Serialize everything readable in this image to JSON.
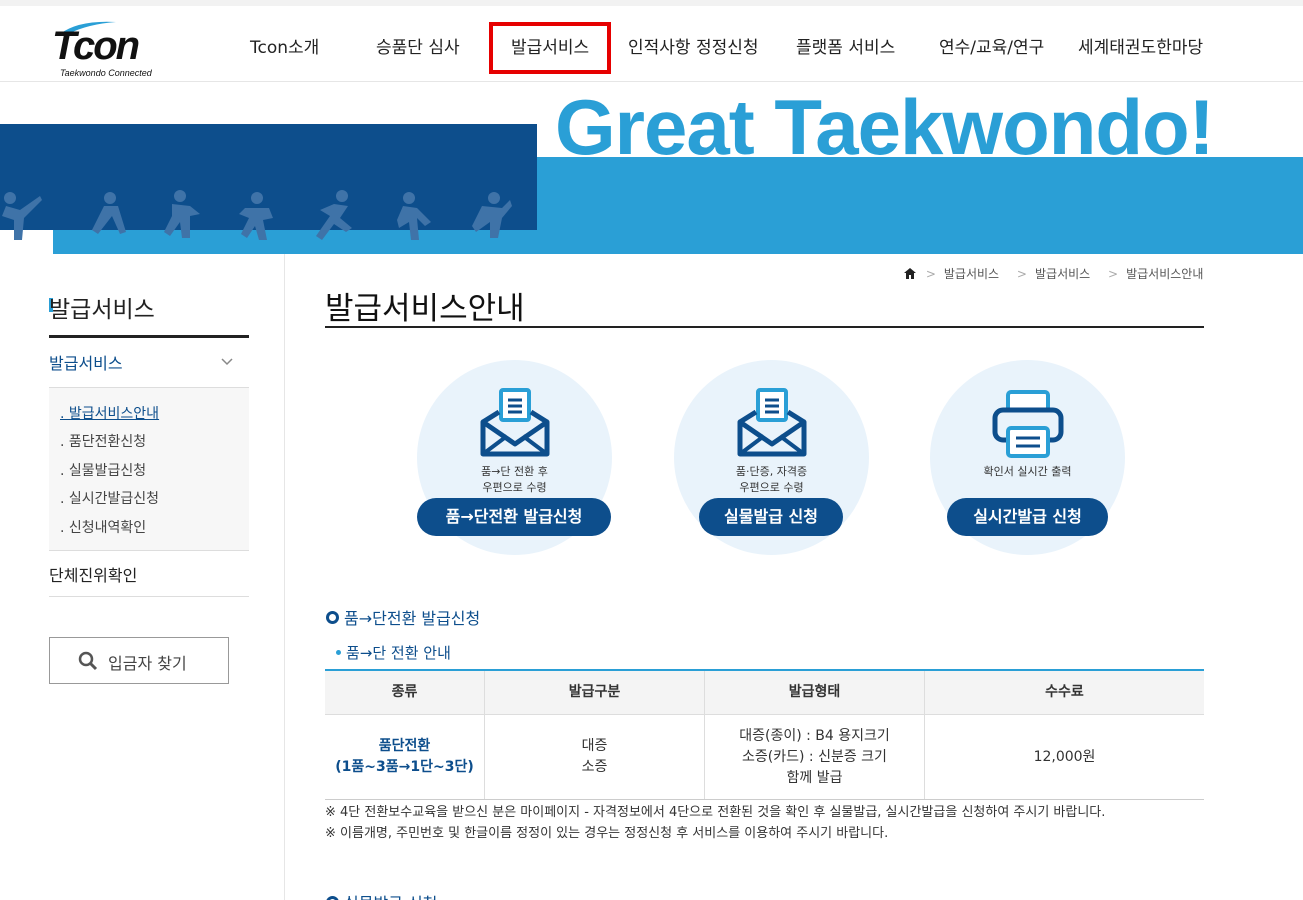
{
  "header": {
    "logo_text": "Tcon",
    "logo_sub": "Taekwondo Connected",
    "nav": [
      {
        "label": "Tcon소개"
      },
      {
        "label": "승품단 심사"
      },
      {
        "label": "발급서비스"
      },
      {
        "label": "인적사항 정정신청"
      },
      {
        "label": "플랫폼 서비스"
      },
      {
        "label": "연수/교육/연구"
      },
      {
        "label": "세계태권도한마당"
      }
    ]
  },
  "banner": {
    "title": "Great Taekwondo!"
  },
  "sidebar": {
    "title": "발급서비스",
    "menu_label": "발급서비스",
    "submenu": [
      {
        "label": ". 발급서비스안내"
      },
      {
        "label": ". 품단전환신청"
      },
      {
        "label": ". 실물발급신청"
      },
      {
        "label": ". 실시간발급신청"
      },
      {
        "label": ". 신청내역확인"
      }
    ],
    "menu2_label": "단체진위확인",
    "find_button": "입금자 찾기"
  },
  "breadcrumb": [
    "발급서비스",
    "발급서비스",
    "발급서비스안내"
  ],
  "page_title": "발급서비스안내",
  "services": [
    {
      "desc1": "품→단 전환 후",
      "desc2": "우편으로 수령",
      "button": "품→단전환 발급신청",
      "icon": "envelope-icon"
    },
    {
      "desc1": "품·단증, 자격증",
      "desc2": "우편으로 수령",
      "button": "실물발급 신청",
      "icon": "envelope-icon"
    },
    {
      "desc1": "확인서 실시간 출력",
      "desc2": "",
      "button": "실시간발급 신청",
      "icon": "printer-icon"
    }
  ],
  "section": {
    "heading": "품→단전환 발급신청",
    "subheading": "품→단 전환 안내",
    "table": {
      "headers": [
        "종류",
        "발급구분",
        "발급형태",
        "수수료"
      ],
      "row": {
        "type_line1": "품단전환",
        "type_line2": "(1품~3품→1단~3단)",
        "kind_line1": "대증",
        "kind_line2": "소증",
        "form_line1": "대증(종이) : B4 용지크기",
        "form_line2": "소증(카드) : 신분증 크기",
        "form_line3": "함께 발급",
        "fee": "12,000원"
      }
    },
    "note1": "※ 4단 전환보수교육을 받으신 분은 마이페이지 - 자격정보에서 4단으로 전환된 것을 확인 후 실물발급, 실시간발급을 신청하여 주시기 바랍니다.",
    "note2": "※ 이름개명, 주민번호 및 한글이름 정정이 있는 경우는 정정신청 후 서비스를 이용하여 주시기 바랍니다."
  },
  "next_section": "실물발급 신청",
  "colors": {
    "navy": "#0d4e8c",
    "sky": "#2a9fd6",
    "highlight": "#e60000"
  }
}
